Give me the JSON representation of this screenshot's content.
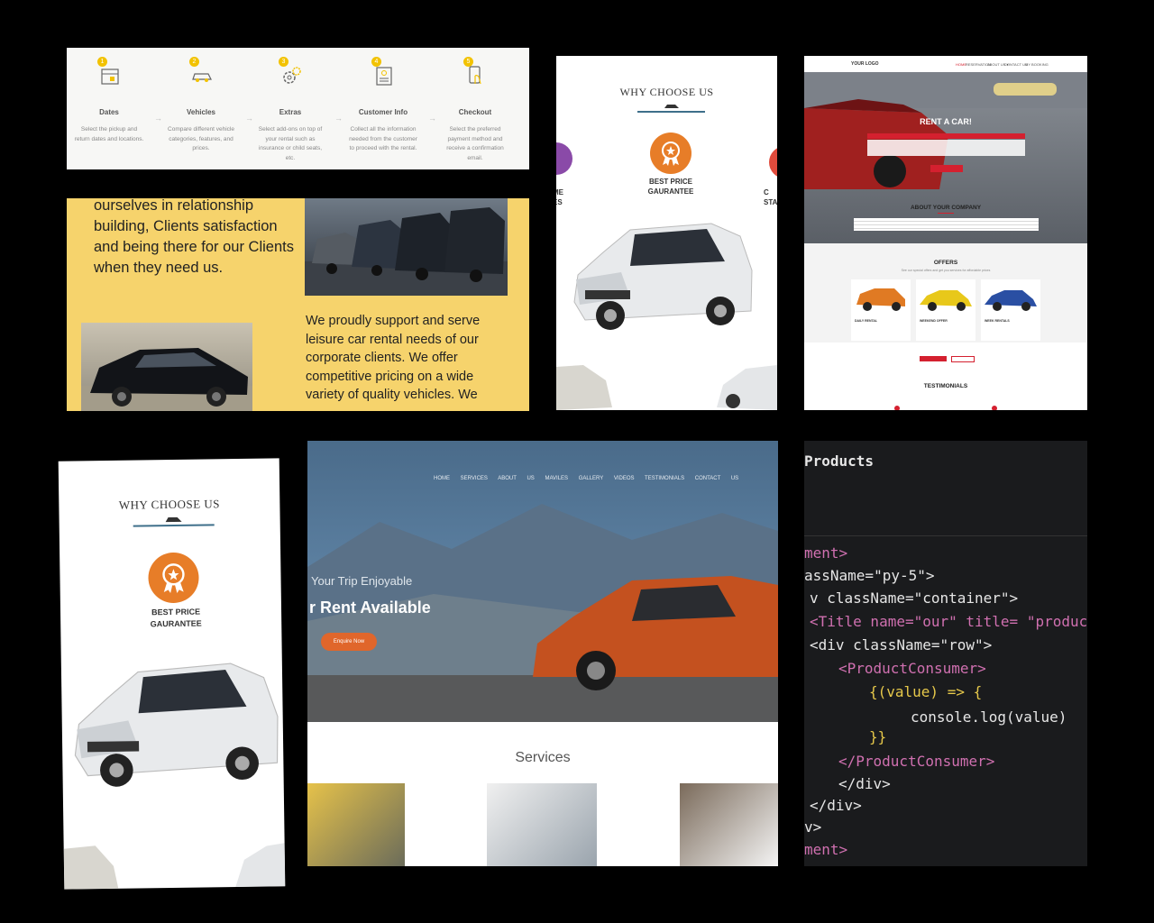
{
  "steps": {
    "items": [
      {
        "num": "1",
        "title": "Dates",
        "desc": "Select the pickup and return dates and locations."
      },
      {
        "num": "2",
        "title": "Vehicles",
        "desc": "Compare different vehicle categories, features, and prices."
      },
      {
        "num": "3",
        "title": "Extras",
        "desc": "Select add-ons on top of your rental such as insurance or child seats, etc."
      },
      {
        "num": "4",
        "title": "Customer Info",
        "desc": "Collect all the information needed from the customer to proceed with the rental."
      },
      {
        "num": "5",
        "title": "Checkout",
        "desc": "Select the preferred payment method and receive a confirmation email."
      }
    ],
    "accent": "#f2c200"
  },
  "promo": {
    "text1": "ourselves in relationship building, Clients satisfaction and being there for our Clients when they need us.",
    "text2": "We proudly support and serve leisure car rental needs of our corporate clients. We offer competitive pricing on a wide variety of quality vehicles. We",
    "bg": "#f6d36c"
  },
  "why1": {
    "title": "WHY CHOOSE US",
    "badge_label": "BEST PRICE GAURANTEE",
    "left_partial": "ME\nES",
    "right_partial": "C\nSTA"
  },
  "why2": {
    "title": "WHY CHOOSE US",
    "badge_label": "BEST PRICE GAURANTEE"
  },
  "rent": {
    "logo": "YOUR LOGO",
    "nav": [
      "HOME",
      "RESERVATION",
      "ABOUT US ▾",
      "CONTACT US",
      "MY BOOKING"
    ],
    "hero_title": "RENT A CAR!",
    "about_title": "ABOUT YOUR COMPANY",
    "offers_title": "OFFERS",
    "offers_sub": "See our special offers and get you services for affordable prices",
    "offers": [
      {
        "name": "DAILY RENTAL",
        "color": "#e07a23"
      },
      {
        "name": "WEEKEND OFFER",
        "color": "#e8c81a"
      },
      {
        "name": "WEEK RENTALS",
        "color": "#2a4fa3"
      }
    ],
    "testimonials_title": "TESTIMONIALS",
    "accent": "#d4202f"
  },
  "services": {
    "menu": "HOME SERVICES ABOUT US MAVILES GALLERY VIDEOS TESTIMONIALS CONTACT US",
    "tagline": "Your Trip Enjoyable",
    "headline": "r Rent Available",
    "button": "Enquire Now",
    "title": "Services",
    "accent": "#e0662b"
  },
  "code": {
    "lines": [
      {
        "text": "Products",
        "color": "#e6e6e6"
      },
      {
        "text": "ment>",
        "color": "#d070b0"
      },
      {
        "text": "assName=\"py-5\">",
        "color": "#e6e6e6"
      },
      {
        "text": "v className=\"container\">",
        "color": "#e6e6e6"
      },
      {
        "text": "<Title name=\"our\" title= \"product",
        "color": "#d070b0"
      },
      {
        "text": "<div className=\"row\">",
        "color": "#e6e6e6"
      },
      {
        "text": "<ProductConsumer>",
        "color": "#d070b0"
      },
      {
        "text": "{(value) => {",
        "color": "#e6c84a"
      },
      {
        "text": "console.log(value)",
        "color": "#e6e6e6"
      },
      {
        "text": "}}",
        "color": "#e6c84a"
      },
      {
        "text": "</ProductConsumer>",
        "color": "#d070b0"
      },
      {
        "text": "</div>",
        "color": "#e6e6e6"
      },
      {
        "text": "</div>",
        "color": "#e6e6e6"
      },
      {
        "text": "v>",
        "color": "#e6e6e6"
      },
      {
        "text": "ment>",
        "color": "#d070b0"
      }
    ]
  }
}
